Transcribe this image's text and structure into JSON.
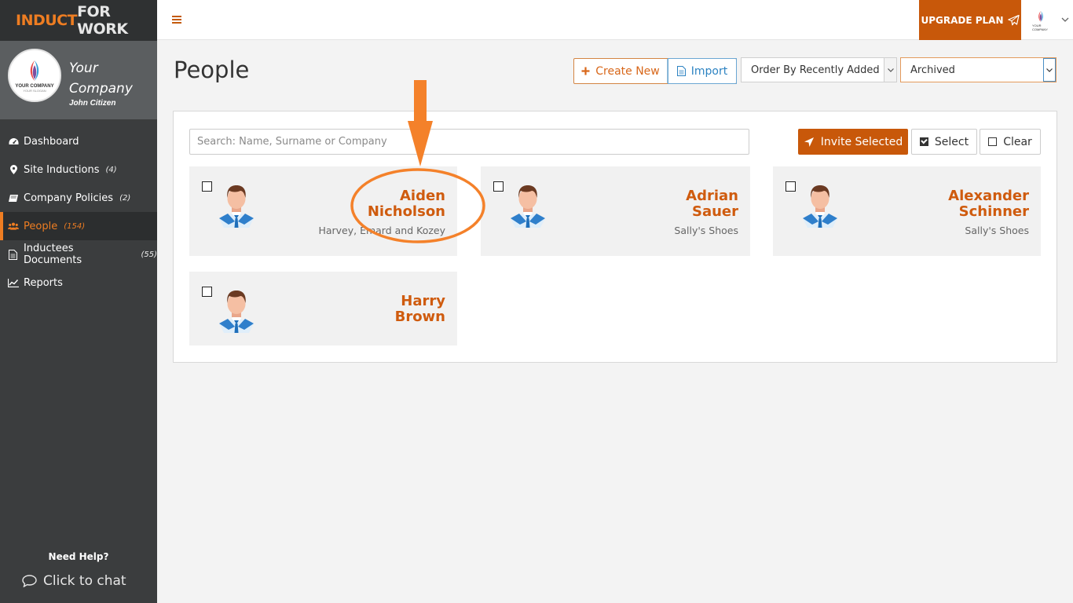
{
  "brand": {
    "part1": "INDUCT",
    "part2": "FOR WORK"
  },
  "company": {
    "name_line1": "Your",
    "name_line2": "Company",
    "user": "John Citizen",
    "logo_text": "YOUR COMPANY",
    "logo_sub": "YOUR SLOGAN"
  },
  "nav": [
    {
      "label": "Dashboard",
      "count": "",
      "icon": "dashboard-icon"
    },
    {
      "label": "Site Inductions",
      "count": "(4)",
      "icon": "map-marker-icon"
    },
    {
      "label": "Company Policies",
      "count": "(2)",
      "icon": "book-icon"
    },
    {
      "label": "People",
      "count": "(154)",
      "icon": "users-icon"
    },
    {
      "label": "Inductees Documents",
      "count": "(55)",
      "icon": "document-icon"
    },
    {
      "label": "Reports",
      "count": "",
      "icon": "line-chart-icon"
    }
  ],
  "help": {
    "title": "Need Help?",
    "chat": "Click to chat"
  },
  "topbar": {
    "upgrade": "UPGRADE PLAN"
  },
  "page": {
    "title": "People",
    "create_label": "Create New",
    "import_label": "Import",
    "order_value": "Order By Recently Added",
    "filter_value": "Archived"
  },
  "toolbar": {
    "search_placeholder": "Search: Name, Surname or Company",
    "invite_label": "Invite Selected",
    "select_label": "Select",
    "clear_label": "Clear"
  },
  "people": [
    {
      "first": "Aiden",
      "last": "Nicholson",
      "company": "Harvey, Emard and Kozey"
    },
    {
      "first": "Adrian",
      "last": "Sauer",
      "company": "Sally's Shoes"
    },
    {
      "first": "Alexander",
      "last": "Schinner",
      "company": "Sally's Shoes"
    },
    {
      "first": "Harry",
      "last": "Brown",
      "company": ""
    }
  ],
  "colors": {
    "accent": "#c8580a",
    "name": "#cf5b0e",
    "sidebar": "#3b3d3e",
    "annotation": "#f4812a"
  }
}
